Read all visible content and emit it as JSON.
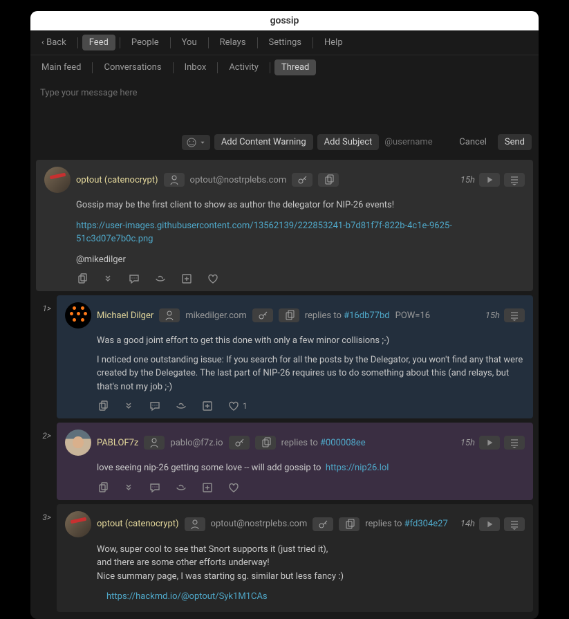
{
  "title": "gossip",
  "nav": {
    "back": "‹ Back",
    "items": [
      "Feed",
      "People",
      "You",
      "Relays",
      "Settings",
      "Help"
    ],
    "active_index": 0
  },
  "subnav": {
    "items": [
      "Main feed",
      "Conversations",
      "Inbox",
      "Activity",
      "Thread"
    ],
    "active_index": 4
  },
  "compose": {
    "placeholder": "Type your message here",
    "add_warning": "Add Content Warning",
    "add_subject": "Add Subject",
    "at_placeholder": "@username",
    "cancel": "Cancel",
    "send": "Send"
  },
  "posts": [
    {
      "depth": "",
      "user": "optout (catenocrypt)",
      "addr": "optout@nostrplebs.com",
      "reply_to": "",
      "pow": "",
      "time": "15h",
      "body_lines": [
        "Gossip may be the first client to show as author the delegator for NIP-26 events!"
      ],
      "link": "https://user-images.githubusercontent.com/13562139/222853241-b7d81f7f-822b-4c1e-9625-51c3d07e7b0c.png",
      "mention": "@mikedilger",
      "like_count": ""
    },
    {
      "depth": "1>",
      "user": "Michael Dilger",
      "addr": "mikedilger.com",
      "reply_to": "#16db77bd",
      "pow": "POW=16",
      "time": "15h",
      "body_lines": [
        "Was a good joint effort to get this done with only a few minor collisions ;-)",
        "",
        "I noticed one outstanding issue: If you search for all the posts by the Delegator, you won't find any that were created by the Delegatee. The last part of NIP-26 requires us to do something about this (and relays, but that's not my job ;-)"
      ],
      "link": "",
      "mention": "",
      "like_count": "1"
    },
    {
      "depth": "2>",
      "user": "PABLOF7z",
      "addr": "pablo@f7z.io",
      "reply_to": "#000008ee",
      "pow": "",
      "time": "15h",
      "body_lines": [
        "love seeing nip-26 getting some love -- will add gossip to"
      ],
      "link": "https://nip26.lol",
      "mention": "",
      "like_count": ""
    },
    {
      "depth": "3>",
      "user": "optout (catenocrypt)",
      "addr": "optout@nostrplebs.com",
      "reply_to": "#fd304e27",
      "pow": "",
      "time": "14h",
      "body_lines": [
        "Wow, super cool to see that Snort supports it (just tried it),",
        "and there are some other efforts underway!",
        "Nice summary page, I was starting sg. similar but less fancy :)"
      ],
      "link": "https://hackmd.io/@optout/Syk1M1CAs",
      "mention": "",
      "like_count": ""
    }
  ],
  "labels": {
    "replies_to": "replies to"
  }
}
